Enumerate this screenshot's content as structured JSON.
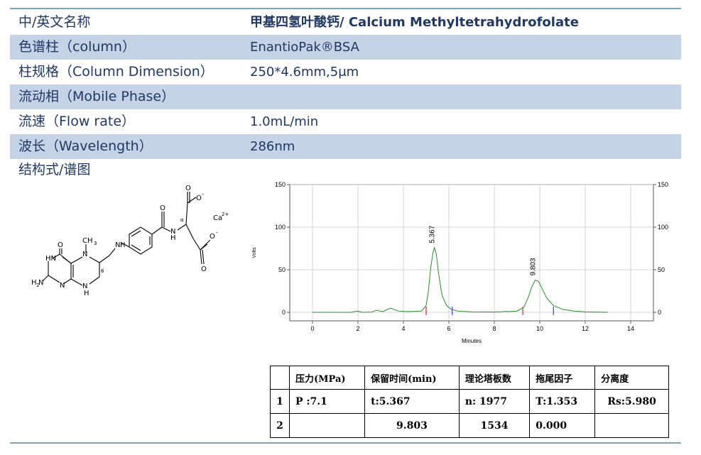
{
  "rows": [
    {
      "label": "中/英文名称",
      "value": "甲基四氢叶酸钙/ Calcium Methyltetrahydrofolate"
    },
    {
      "label": "色谱柱（column）",
      "value": "EnantioPak®BSA"
    },
    {
      "label": "柱规格（Column Dimension）",
      "value": "250*4.6mm,5μm"
    },
    {
      "label": "流动相（Mobile Phase）",
      "value": ""
    },
    {
      "label": "流速（Flow rate）",
      "value": "1.0mL/min"
    },
    {
      "label": "波长（Wavelength）",
      "value": "286nm"
    }
  ],
  "structure_title": "结构式/谱图",
  "structure_labels": {
    "ca": "Ca",
    "ca_charge": "2+",
    "o_minus": "O",
    "minus": "-",
    "o": "O",
    "n": "N",
    "h": "H",
    "hn": "HN",
    "nh": "NH",
    "ch3": "CH",
    "three": "3",
    "h2n": "H",
    "two": "2",
    "alpha": "α",
    "six": "6"
  },
  "chart_data": {
    "type": "line",
    "xlabel": "Minutes",
    "ylabel": "Volts",
    "xlim": [
      -1,
      15
    ],
    "ylim": [
      -10,
      150
    ],
    "xticks": [
      0,
      2,
      4,
      6,
      8,
      10,
      12,
      14
    ],
    "yticks": [
      0,
      50,
      100,
      150
    ],
    "series": [
      {
        "x": [
          0,
          1.7,
          1.85,
          1.95,
          2.05,
          2.2,
          2.6,
          2.75,
          2.85,
          2.95,
          3.1,
          3.3,
          3.45,
          3.6,
          3.8,
          4.2,
          4.8,
          5.0,
          5.1,
          5.2,
          5.3,
          5.367,
          5.45,
          5.55,
          5.7,
          5.9,
          6.1,
          6.4,
          7.0,
          8.0,
          8.4,
          8.5,
          8.6,
          9.0,
          9.3,
          9.5,
          9.65,
          9.803,
          9.95,
          10.1,
          10.3,
          10.6,
          11.0,
          11.5,
          12.0,
          13.0
        ],
        "y": [
          0,
          0,
          0.8,
          1.5,
          0.8,
          0,
          0.3,
          1.8,
          2.5,
          1.5,
          0.8,
          3.5,
          5,
          3.2,
          1.5,
          0.8,
          1.5,
          8,
          25,
          52,
          70,
          76,
          68,
          45,
          20,
          8,
          3.5,
          1.5,
          0.5,
          0.3,
          0.8,
          1.2,
          0.8,
          1.5,
          6,
          18,
          30,
          38,
          36,
          28,
          17,
          8,
          3.5,
          1.5,
          0.5,
          0
        ]
      }
    ],
    "peak_labels": [
      {
        "x": 5.367,
        "y": 76,
        "text": "5.367"
      },
      {
        "x": 9.803,
        "y": 38,
        "text": "9.803"
      }
    ],
    "markers": [
      {
        "x": 5.0,
        "color": "#d40000"
      },
      {
        "x": 6.15,
        "color": "#1a1acc"
      },
      {
        "x": 9.25,
        "color": "#d40000"
      },
      {
        "x": 10.6,
        "color": "#1a1acc"
      }
    ],
    "grid": true
  },
  "results_table": {
    "headers": [
      "",
      "压力(MPa)",
      "保留时间(min)",
      "理论塔板数",
      "拖尾因子",
      "分离度"
    ],
    "rows": [
      [
        "1",
        "P :7.1",
        "t:5.367",
        "n:  1977",
        "T:1.353",
        "Rs:5.980"
      ],
      [
        "2",
        "",
        "9.803",
        "1534",
        "0.000",
        ""
      ]
    ]
  },
  "colors": {
    "header_text": "#1f3864",
    "row_shade": "#c5d3e6",
    "rule": "#7f9fc4",
    "trace": "#2e8b2e"
  }
}
